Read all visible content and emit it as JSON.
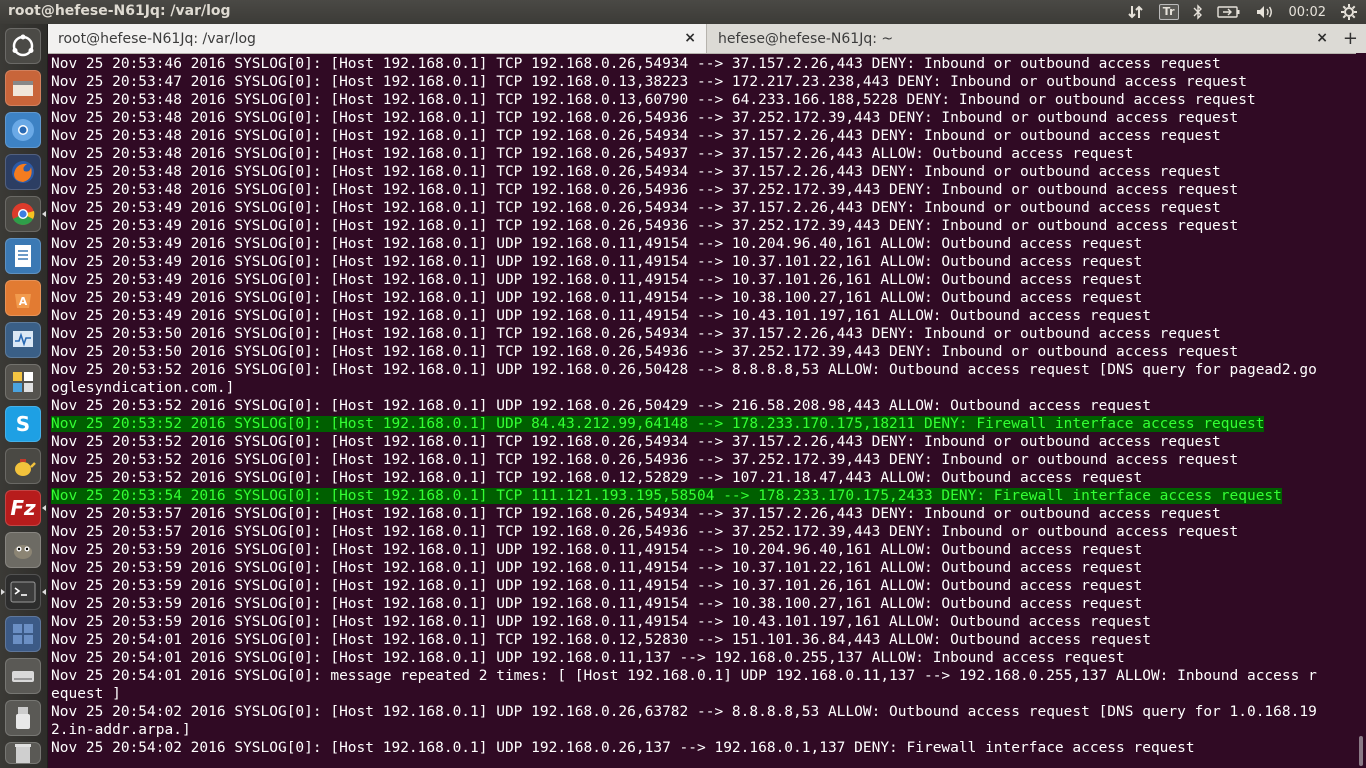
{
  "topbar": {
    "window_title": "root@hefese-N61Jq: /var/log",
    "keyboard_indicator": "Tr",
    "clock": "00:02",
    "icons": [
      "network-transfer-icon",
      "keyboard-icon",
      "bluetooth-icon",
      "battery-icon",
      "volume-icon",
      "gear-icon"
    ]
  },
  "launcher": {
    "items": [
      "ubuntu-dash-icon",
      "files-icon",
      "chromium-icon",
      "firefox-icon",
      "chrome-icon",
      "libreoffice-writer-icon",
      "software-center-icon",
      "system-monitor-icon",
      "apps-icon",
      "skype-icon",
      "teapot-icon",
      "filezilla-icon",
      "gimp-icon",
      "terminal-icon",
      "workspace-switcher-icon",
      "drive-icon",
      "usb-icon",
      "trash-icon"
    ]
  },
  "tabs": [
    {
      "label": "root@hefese-N61Jq: /var/log",
      "close": "×"
    },
    {
      "label": "hefese@hefese-N61Jq: ~",
      "close": "×"
    }
  ],
  "new_tab": "+",
  "lines": [
    {
      "text": "Nov 25 20:53:46 2016 SYSLOG[0]: [Host 192.168.0.1] TCP 192.168.0.26,54934 --> 37.157.2.26,443 DENY: Inbound or outbound access request"
    },
    {
      "text": "Nov 25 20:53:47 2016 SYSLOG[0]: [Host 192.168.0.1] TCP 192.168.0.13,38223 --> 172.217.23.238,443 DENY: Inbound or outbound access request"
    },
    {
      "text": "Nov 25 20:53:48 2016 SYSLOG[0]: [Host 192.168.0.1] TCP 192.168.0.13,60790 --> 64.233.166.188,5228 DENY: Inbound or outbound access request"
    },
    {
      "text": "Nov 25 20:53:48 2016 SYSLOG[0]: [Host 192.168.0.1] TCP 192.168.0.26,54936 --> 37.252.172.39,443 DENY: Inbound or outbound access request"
    },
    {
      "text": "Nov 25 20:53:48 2016 SYSLOG[0]: [Host 192.168.0.1] TCP 192.168.0.26,54934 --> 37.157.2.26,443 DENY: Inbound or outbound access request"
    },
    {
      "text": "Nov 25 20:53:48 2016 SYSLOG[0]: [Host 192.168.0.1] TCP 192.168.0.26,54937 --> 37.157.2.26,443 ALLOW: Outbound access request"
    },
    {
      "text": "Nov 25 20:53:48 2016 SYSLOG[0]: [Host 192.168.0.1] TCP 192.168.0.26,54934 --> 37.157.2.26,443 DENY: Inbound or outbound access request"
    },
    {
      "text": "Nov 25 20:53:48 2016 SYSLOG[0]: [Host 192.168.0.1] TCP 192.168.0.26,54936 --> 37.252.172.39,443 DENY: Inbound or outbound access request"
    },
    {
      "text": "Nov 25 20:53:49 2016 SYSLOG[0]: [Host 192.168.0.1] TCP 192.168.0.26,54934 --> 37.157.2.26,443 DENY: Inbound or outbound access request"
    },
    {
      "text": "Nov 25 20:53:49 2016 SYSLOG[0]: [Host 192.168.0.1] TCP 192.168.0.26,54936 --> 37.252.172.39,443 DENY: Inbound or outbound access request"
    },
    {
      "text": "Nov 25 20:53:49 2016 SYSLOG[0]: [Host 192.168.0.1] UDP 192.168.0.11,49154 --> 10.204.96.40,161 ALLOW: Outbound access request"
    },
    {
      "text": "Nov 25 20:53:49 2016 SYSLOG[0]: [Host 192.168.0.1] UDP 192.168.0.11,49154 --> 10.37.101.22,161 ALLOW: Outbound access request"
    },
    {
      "text": "Nov 25 20:53:49 2016 SYSLOG[0]: [Host 192.168.0.1] UDP 192.168.0.11,49154 --> 10.37.101.26,161 ALLOW: Outbound access request"
    },
    {
      "text": "Nov 25 20:53:49 2016 SYSLOG[0]: [Host 192.168.0.1] UDP 192.168.0.11,49154 --> 10.38.100.27,161 ALLOW: Outbound access request"
    },
    {
      "text": "Nov 25 20:53:49 2016 SYSLOG[0]: [Host 192.168.0.1] UDP 192.168.0.11,49154 --> 10.43.101.197,161 ALLOW: Outbound access request"
    },
    {
      "text": "Nov 25 20:53:50 2016 SYSLOG[0]: [Host 192.168.0.1] TCP 192.168.0.26,54934 --> 37.157.2.26,443 DENY: Inbound or outbound access request"
    },
    {
      "text": "Nov 25 20:53:50 2016 SYSLOG[0]: [Host 192.168.0.1] TCP 192.168.0.26,54936 --> 37.252.172.39,443 DENY: Inbound or outbound access request"
    },
    {
      "text": "Nov 25 20:53:52 2016 SYSLOG[0]: [Host 192.168.0.1] UDP 192.168.0.26,50428 --> 8.8.8.8,53 ALLOW: Outbound access request [DNS query for pagead2.go"
    },
    {
      "text": "oglesyndication.com.]"
    },
    {
      "text": "Nov 25 20:53:52 2016 SYSLOG[0]: [Host 192.168.0.1] UDP 192.168.0.26,50429 --> 216.58.208.98,443 ALLOW: Outbound access request"
    },
    {
      "text": "Nov 25 20:53:52 2016 SYSLOG[0]: [Host 192.168.0.1] UDP 84.43.212.99,64148 --> 178.233.170.175,18211 DENY: Firewall interface access request",
      "highlight": true
    },
    {
      "text": "Nov 25 20:53:52 2016 SYSLOG[0]: [Host 192.168.0.1] TCP 192.168.0.26,54934 --> 37.157.2.26,443 DENY: Inbound or outbound access request"
    },
    {
      "text": "Nov 25 20:53:52 2016 SYSLOG[0]: [Host 192.168.0.1] TCP 192.168.0.26,54936 --> 37.252.172.39,443 DENY: Inbound or outbound access request"
    },
    {
      "text": "Nov 25 20:53:52 2016 SYSLOG[0]: [Host 192.168.0.1] TCP 192.168.0.12,52829 --> 107.21.18.47,443 ALLOW: Outbound access request"
    },
    {
      "text": "Nov 25 20:53:54 2016 SYSLOG[0]: [Host 192.168.0.1] TCP 111.121.193.195,58504 --> 178.233.170.175,2433 DENY: Firewall interface access request",
      "highlight": true
    },
    {
      "text": "Nov 25 20:53:57 2016 SYSLOG[0]: [Host 192.168.0.1] TCP 192.168.0.26,54934 --> 37.157.2.26,443 DENY: Inbound or outbound access request"
    },
    {
      "text": "Nov 25 20:53:57 2016 SYSLOG[0]: [Host 192.168.0.1] TCP 192.168.0.26,54936 --> 37.252.172.39,443 DENY: Inbound or outbound access request"
    },
    {
      "text": "Nov 25 20:53:59 2016 SYSLOG[0]: [Host 192.168.0.1] UDP 192.168.0.11,49154 --> 10.204.96.40,161 ALLOW: Outbound access request"
    },
    {
      "text": "Nov 25 20:53:59 2016 SYSLOG[0]: [Host 192.168.0.1] UDP 192.168.0.11,49154 --> 10.37.101.22,161 ALLOW: Outbound access request"
    },
    {
      "text": "Nov 25 20:53:59 2016 SYSLOG[0]: [Host 192.168.0.1] UDP 192.168.0.11,49154 --> 10.37.101.26,161 ALLOW: Outbound access request"
    },
    {
      "text": "Nov 25 20:53:59 2016 SYSLOG[0]: [Host 192.168.0.1] UDP 192.168.0.11,49154 --> 10.38.100.27,161 ALLOW: Outbound access request"
    },
    {
      "text": "Nov 25 20:53:59 2016 SYSLOG[0]: [Host 192.168.0.1] UDP 192.168.0.11,49154 --> 10.43.101.197,161 ALLOW: Outbound access request"
    },
    {
      "text": "Nov 25 20:54:01 2016 SYSLOG[0]: [Host 192.168.0.1] TCP 192.168.0.12,52830 --> 151.101.36.84,443 ALLOW: Outbound access request"
    },
    {
      "text": "Nov 25 20:54:01 2016 SYSLOG[0]: [Host 192.168.0.1] UDP 192.168.0.11,137 --> 192.168.0.255,137 ALLOW: Inbound access request"
    },
    {
      "text": "Nov 25 20:54:01 2016 SYSLOG[0]: message repeated 2 times: [ [Host 192.168.0.1] UDP 192.168.0.11,137 --> 192.168.0.255,137 ALLOW: Inbound access r"
    },
    {
      "text": "equest ]"
    },
    {
      "text": "Nov 25 20:54:02 2016 SYSLOG[0]: [Host 192.168.0.1] UDP 192.168.0.26,63782 --> 8.8.8.8,53 ALLOW: Outbound access request [DNS query for 1.0.168.19"
    },
    {
      "text": "2.in-addr.arpa.]"
    },
    {
      "text": "Nov 25 20:54:02 2016 SYSLOG[0]: [Host 192.168.0.1] UDP 192.168.0.26,137 --> 192.168.0.1,137 DENY: Firewall interface access request"
    }
  ],
  "colors": {
    "terminal_bg": "#300a24",
    "highlight_bg": "#005f00",
    "highlight_fg": "#33ff33"
  }
}
